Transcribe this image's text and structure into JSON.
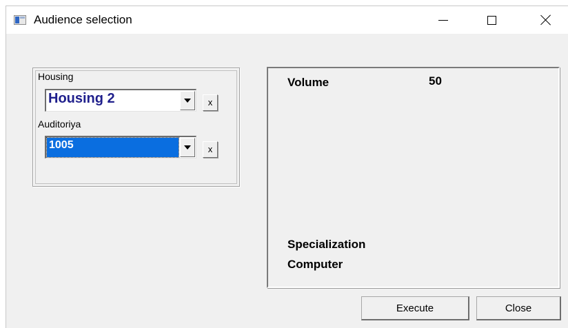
{
  "window": {
    "title": "Audience selection",
    "icon": "app-window-icon",
    "controls": [
      "minimize-icon",
      "maximize-icon",
      "close-icon"
    ]
  },
  "selection": {
    "housing_label": "Housing",
    "housing_value": "Housing 2",
    "housing_clear_label": "x",
    "auditoriya_label": "Auditoriya",
    "auditoriya_value": "1005",
    "auditoriya_clear_label": "x"
  },
  "info": {
    "volume_label": "Volume",
    "volume_value": "50",
    "specialization_label": "Specialization",
    "specialization_value": "Computer"
  },
  "actions": {
    "execute_label": "Execute",
    "close_label": "Close"
  },
  "colors": {
    "combo_text": "#1f1f8c",
    "selection_highlight": "#0a6ee0",
    "window_bg": "#f0f0f0"
  }
}
